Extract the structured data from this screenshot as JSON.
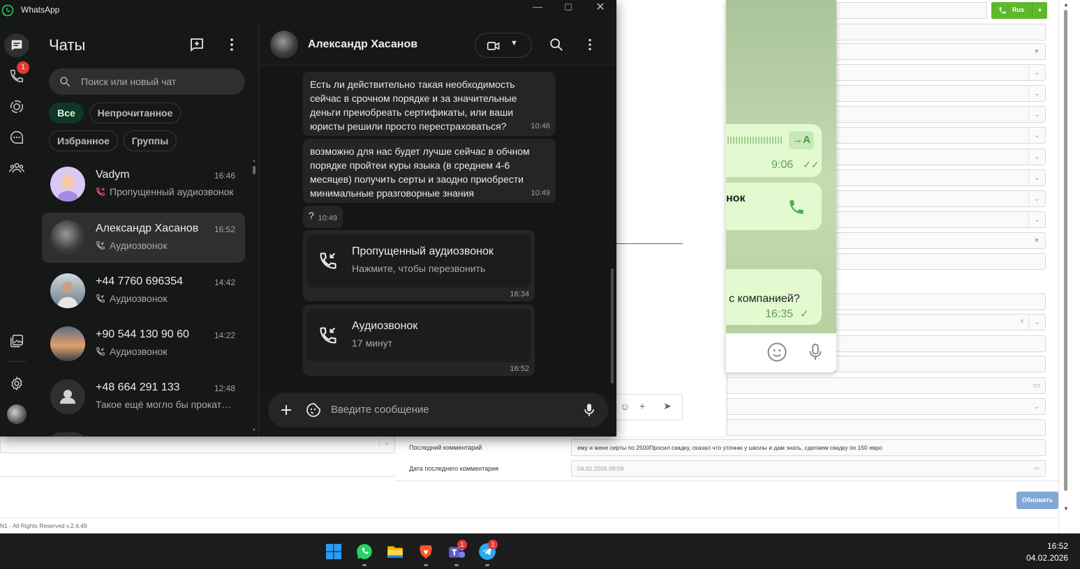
{
  "window": {
    "title": "WhatsApp",
    "controls": [
      "minimize",
      "maximize",
      "close"
    ]
  },
  "rail": {
    "items": [
      {
        "name": "chats",
        "icon": "chat-icon",
        "active": true
      },
      {
        "name": "calls",
        "icon": "phone-icon",
        "badge": "1"
      },
      {
        "name": "status",
        "icon": "status-icon"
      },
      {
        "name": "channels",
        "icon": "channels-icon"
      },
      {
        "name": "communities",
        "icon": "communities-icon"
      },
      {
        "name": "media",
        "icon": "media-icon"
      },
      {
        "name": "settings",
        "icon": "gear-icon"
      },
      {
        "name": "profile",
        "icon": "avatar"
      }
    ]
  },
  "chat_list": {
    "title": "Чаты",
    "search_placeholder": "Поиск или новый чат",
    "filters": [
      "Все",
      "Непрочитанное",
      "Избранное",
      "Группы"
    ],
    "active_filter": "Все",
    "chats": [
      {
        "name": "Vadym",
        "time": "16:46",
        "preview": "Пропущенный аудиозвонок",
        "preview_icon": "missed-call-icon"
      },
      {
        "name": "Александр Хасанов",
        "time": "16:52",
        "preview": "Аудиозвонок",
        "preview_icon": "call-icon",
        "selected": true
      },
      {
        "name": "+44 7760 696354",
        "time": "14:42",
        "preview": "Аудиозвонок",
        "preview_icon": "call-icon"
      },
      {
        "name": "+90 544 130 90 60",
        "time": "14:22",
        "preview": "Аудиозвонок",
        "preview_icon": "call-icon"
      },
      {
        "name": "+48 664 291 133",
        "time": "12:48",
        "preview": "Такое ещё могло бы прокатить"
      }
    ]
  },
  "conversation": {
    "contact_name": "Александр Хасанов",
    "messages": [
      {
        "text": "Есть ли действительно такая необходимость сейчас в срочном порядке и за значительные деньги преиобреать сертификаты, или ваши юристы решили просто перестраховаться?",
        "time": "10:46"
      },
      {
        "text": "возможно для нас будет лучше сейчас в обчном порядке пройтеи куры языка (в среднем 4-6 месяцев) получить серты и заодно приобрести минимальные рразговорные знания",
        "time": "10:49"
      },
      {
        "text": "?",
        "time": "10:49"
      }
    ],
    "calls": [
      {
        "title": "Пропущенный аудиозвонок",
        "subtitle": "Нажмите, чтобы перезвонить",
        "time": "16:34"
      },
      {
        "title": "Аудиозвонок",
        "subtitle": "17 минут",
        "time": "16:52"
      }
    ],
    "input_placeholder": "Введите сообщение"
  },
  "telegram": {
    "bubbles": [
      {
        "time": "9:06",
        "translate": "→A"
      },
      {
        "text": "нок"
      },
      {
        "text": "с компанией?",
        "time": "16:35"
      }
    ]
  },
  "crm": {
    "phone_button": "Rus",
    "rows": [
      {
        "label": "Последний комментарий",
        "value": "ему и жене серты по 2500Просил скидку, сказал что уточню у школы и дам знать, сделаем скидку по 150 евро"
      },
      {
        "label": "Дата последнего комментария",
        "value": "04.02.2026 09:59"
      }
    ],
    "update_button": "Обновить",
    "footer": "N1 - All Rights Reserved v.2.4.49"
  },
  "taskbar": {
    "time": "16:52",
    "date": "04.02.2026",
    "apps": [
      {
        "name": "start",
        "icon": "windows-icon"
      },
      {
        "name": "whatsapp",
        "icon": "whatsapp-icon"
      },
      {
        "name": "explorer",
        "icon": "folder-icon"
      },
      {
        "name": "brave",
        "icon": "brave-icon"
      },
      {
        "name": "teams",
        "icon": "teams-icon",
        "badge": "1"
      },
      {
        "name": "telegram",
        "icon": "telegram-icon",
        "badge": "1"
      }
    ]
  }
}
